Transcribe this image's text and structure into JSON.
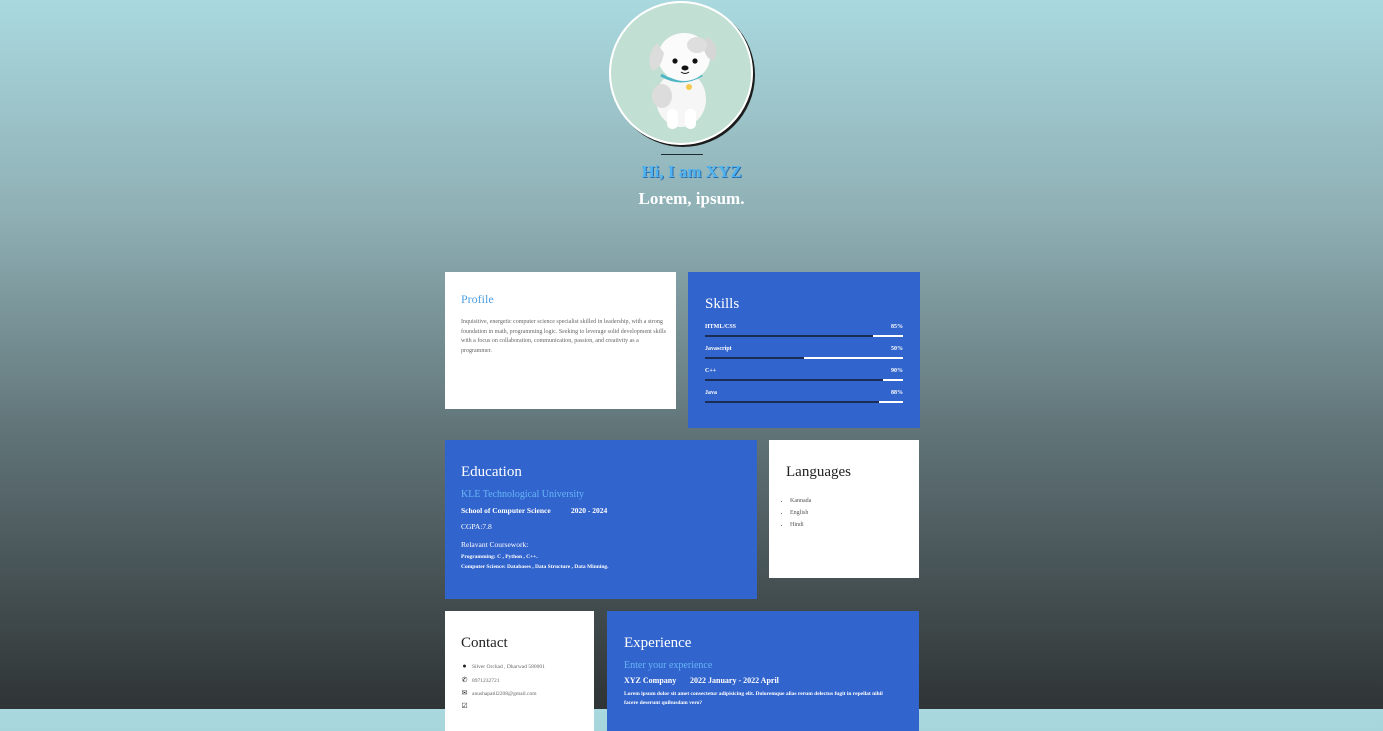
{
  "hero": {
    "greeting": "Hi, I am XYZ",
    "tagline": "Lorem, ipsum."
  },
  "profile": {
    "title": "Profile",
    "text": "Inquisitive, energetic computer science specialist skilled in leadership, with a strong foundation in math, programming logic. Seeking to leverage solid development skills with a focus on collaboration, communication, passion, and creativity as a programmer."
  },
  "skills": {
    "title": "Skills",
    "items": [
      {
        "name": "HTML/CSS",
        "percent_label": "85%",
        "level": 0.15
      },
      {
        "name": "Javascript",
        "percent_label": "50%",
        "level": 0.5
      },
      {
        "name": "C++",
        "percent_label": "90%",
        "level": 0.1
      },
      {
        "name": "Java",
        "percent_label": "88%",
        "level": 0.12
      }
    ]
  },
  "education": {
    "title": "Education",
    "university": "KLE Technological University",
    "school": "School of Computer Science",
    "years": "2020 - 2024",
    "cgpa": "CGPA:7.8",
    "coursework_title": "Relavant Coursework:",
    "coursework_line1": "Programming: C , Python , C++.",
    "coursework_line2": "Computer Science: Databases , Data Structure , Data Minning."
  },
  "languages": {
    "title": "Languages",
    "items": [
      "Kannada",
      "English",
      "Hindi"
    ]
  },
  "contact": {
    "title": "Contact",
    "address": "Silver Orchad , Dharwad 580001",
    "phone": "8971232721",
    "email": "anushapatil2208@gmail.com",
    "icons": [
      "map-marker-icon",
      "phone-icon",
      "envelope-icon",
      "checkbox-icon"
    ]
  },
  "experience": {
    "title": "Experience",
    "subtitle": "Enter your experience",
    "company": "XYZ Company",
    "dates": "2022 January - 2022 April",
    "description": "Lorem ipsum dolor sit amet consectetur adipisicing elit. Doloremque alias rerum delectus fugit in repellat nihil facere deserunt quibusdam vero?"
  },
  "colors": {
    "accent_blue": "#3264cd",
    "link_blue": "#67b6f7",
    "card_white": "#ffffff"
  }
}
